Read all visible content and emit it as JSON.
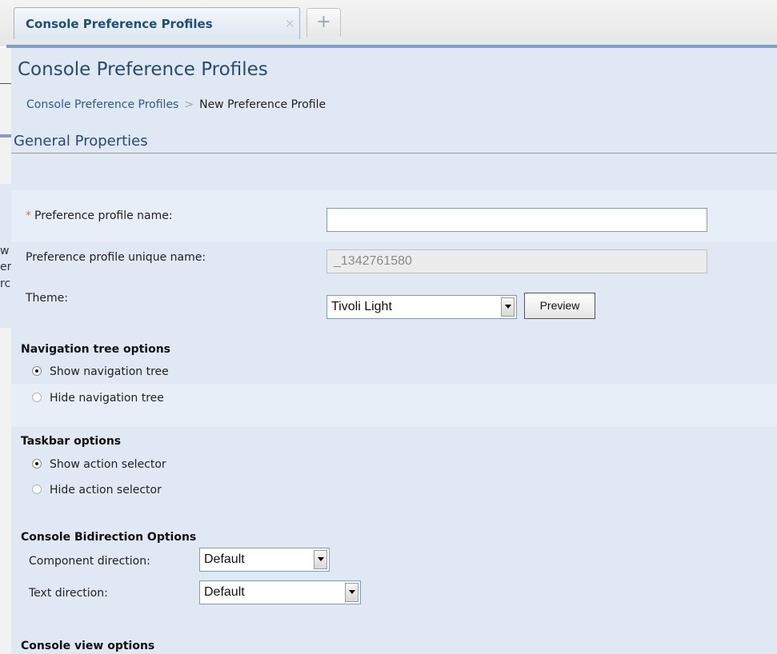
{
  "tabs": {
    "active_label": "Console Preference Profiles",
    "close_glyph": "×",
    "add_glyph": "+"
  },
  "page": {
    "title": "Console Preference Profiles",
    "breadcrumb": {
      "link": "Console Preference Profiles",
      "separator": ">",
      "current": "New Preference Profile"
    },
    "section_title": "General Properties"
  },
  "form": {
    "required_mark": "*",
    "profile_name_label": "Preference profile name:",
    "profile_name_value": "",
    "unique_name_label": "Preference profile unique name:",
    "unique_name_value": "_1342761580",
    "theme_label": "Theme:",
    "theme_value": "Tivoli Light",
    "preview_button": "Preview"
  },
  "navigation_tree_options": {
    "title": "Navigation tree options",
    "options": [
      "Show navigation tree",
      "Hide navigation tree"
    ],
    "selected": "Show navigation tree"
  },
  "taskbar_options": {
    "title": "Taskbar options",
    "options": [
      "Show action selector",
      "Hide action selector"
    ],
    "selected": "Show action selector"
  },
  "bidi_options": {
    "title": "Console Bidirection Options",
    "component_direction_label": "Component direction:",
    "component_direction_value": "Default",
    "text_direction_label": "Text direction:",
    "text_direction_value": "Default"
  },
  "view_options": {
    "title": "Console view options"
  },
  "background_fragments": [
    "w",
    "er",
    "rc"
  ],
  "colors": {
    "panel_bg": "#dfe8f3",
    "title_blue": "#2a4a72",
    "link_blue": "#2d5b8e",
    "accent_rule": "#7fa0c6",
    "required_orange": "#e07a2a"
  }
}
